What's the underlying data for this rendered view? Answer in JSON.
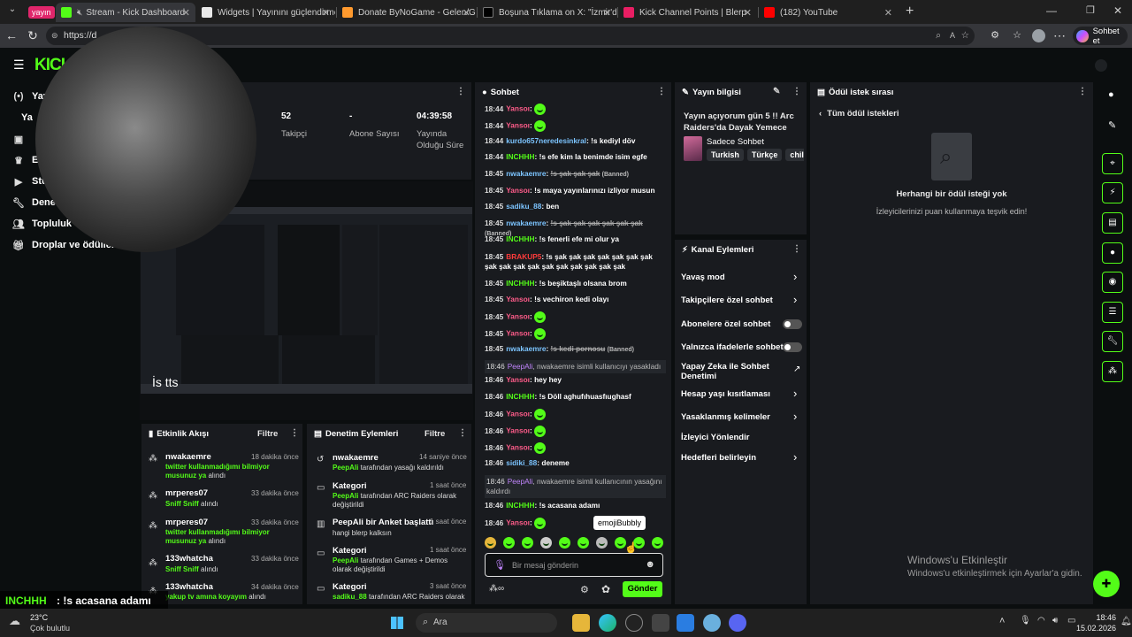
{
  "browser": {
    "tab_group": "yayın",
    "tabs": [
      {
        "title": "Stream - Kick Dashboard",
        "color": "#53fc18"
      },
      {
        "title": "Widgets | Yayınını güçlendirmek iç",
        "color": "#ffffff"
      },
      {
        "title": "Donate ByNoGame - Gelen/Giden",
        "color": "#ff9a2e"
      },
      {
        "title": "Boşuna Tıklama on X: \"İzmir'de bir",
        "color": "#000000"
      },
      {
        "title": "Kick Channel Points | Blerp",
        "color": "#e91e63"
      },
      {
        "title": "(182) YouTube",
        "color": "#ff0000"
      }
    ],
    "url": "https://d",
    "chat_button": "Sohbet et"
  },
  "sidebar": {
    "items": [
      {
        "label": "Yay",
        "icon": "broadcast-icon"
      },
      {
        "label": "Ya",
        "icon": ""
      },
      {
        "label": "",
        "icon": "layout-icon"
      },
      {
        "label": "E",
        "icon": "trophy-icon"
      },
      {
        "label": "Stu",
        "icon": "video-icon"
      },
      {
        "label": "Dene",
        "icon": "wrench-icon"
      },
      {
        "label": "Topluluk",
        "icon": "people-icon"
      },
      {
        "label": "Droplar ve ödüller",
        "icon": "gift-icon"
      }
    ]
  },
  "stats": [
    {
      "value": "52",
      "label": "Takipçi"
    },
    {
      "value": "-",
      "label": "Abone Sayısı"
    },
    {
      "value": "04:39:58",
      "label": "Yayında Olduğu Süre"
    }
  ],
  "overlay_caption": "İs tts",
  "activity": {
    "title": "Etkinlik Akışı",
    "filter": "Filtre",
    "items": [
      {
        "name": "nwakaemre",
        "time": "18 dakika önce",
        "text": "twitter kullanmadığımı bilmiyor musunuz ya",
        "suffix": "alındı"
      },
      {
        "name": "mrperes07",
        "time": "33 dakika önce",
        "text": "Sniff Sniff",
        "suffix": "alındı"
      },
      {
        "name": "mrperes07",
        "time": "33 dakika önce",
        "text": "twitter kullanmadığımı bilmiyor musunuz ya",
        "suffix": "alındı"
      },
      {
        "name": "133whatcha",
        "time": "33 dakika önce",
        "text": "Sniff Sniff",
        "suffix": "alındı"
      },
      {
        "name": "133whatcha",
        "time": "34 dakika önce",
        "text": "yakup tv amına koyayım",
        "suffix": "alındı"
      }
    ]
  },
  "moderation": {
    "title": "Denetim Eylemleri",
    "filter": "Filtre",
    "items": [
      {
        "title": "nwakaemre",
        "time": "14 saniye önce",
        "actor": "PeepAli",
        "text": "tarafından yasağı kaldırıldı",
        "icon": "undo-icon"
      },
      {
        "title": "Kategori",
        "time": "1 saat önce",
        "actor": "PeepAli",
        "text": "tarafından ARC Raiders olarak değiştirildi",
        "icon": "category-icon"
      },
      {
        "title": "PeepAli bir Anket başlattı",
        "time": "1 saat önce",
        "actor": "",
        "text": "hangi blerp kalksın",
        "icon": "poll-icon"
      },
      {
        "title": "Kategori",
        "time": "1 saat önce",
        "actor": "PeepAli",
        "text": "tarafından Games + Demos olarak değiştirildi",
        "icon": "category-icon"
      },
      {
        "title": "Kategori",
        "time": "3 saat önce",
        "actor": "sadiku_88",
        "text": "tarafından ARC Raiders olarak",
        "icon": "category-icon"
      }
    ]
  },
  "chat": {
    "title": "Sohbet",
    "lines": [
      {
        "time": "18:44",
        "user": "Yansoı",
        "color": "pink",
        "text": "",
        "emote": true
      },
      {
        "time": "18:44",
        "user": "Yansoı",
        "color": "pink",
        "text": "",
        "emote": true
      },
      {
        "time": "18:44",
        "user": "kurdo657neredesinkral",
        "color": "blue",
        "text": "!s kediyl döv"
      },
      {
        "time": "18:44",
        "user": "INCHHH",
        "color": "green",
        "text": "!s efe kim la benimde isim egfe"
      },
      {
        "time": "18:45",
        "user": "nwakaemre",
        "color": "blue",
        "text": "!s şak şak şak",
        "banned": "(Banned)"
      },
      {
        "time": "18:45",
        "user": "Yansoı",
        "color": "pink",
        "text": "!s maya yayınlarınızı izliyor musun"
      },
      {
        "time": "18:45",
        "user": "sadiku_88",
        "color": "blue",
        "text": "ben"
      },
      {
        "time": "18:45",
        "user": "nwakaemre",
        "color": "blue",
        "text": "!s şak şak şak şak şak şak",
        "banned": "(Banned)"
      },
      {
        "time": "18:45",
        "user": "INCHHH",
        "color": "green",
        "text": "!s fenerli efe mi olur ya"
      },
      {
        "time": "18:45",
        "user": "BRAKUP5",
        "color": "red",
        "text": "!s şak şak şak şak şak şak şak şak şak şak şak şak şak şak şak şak şak"
      },
      {
        "time": "18:45",
        "user": "INCHHH",
        "color": "green",
        "text": "!s beşiktaşlı olsana brom"
      },
      {
        "time": "18:45",
        "user": "Yansoı",
        "color": "pink",
        "text": "!s vechiron kedi olayı"
      },
      {
        "time": "18:45",
        "user": "Yansoı",
        "color": "pink",
        "text": "",
        "emote": true
      },
      {
        "time": "18:45",
        "user": "Yansoı",
        "color": "pink",
        "text": "",
        "emote": true
      },
      {
        "time": "18:45",
        "user": "nwakaemre",
        "color": "blue",
        "text": "!s kedi pornosu",
        "banned": "(Banned)"
      },
      {
        "time": "18:46",
        "user": "PeepAli",
        "color": "mod",
        "text": "nwakaemre isimli kullanıcıyı yasakladı"
      },
      {
        "time": "18:46",
        "user": "Yansoı",
        "color": "pink",
        "text": "hey hey"
      },
      {
        "time": "18:46",
        "user": "INCHHH",
        "color": "green",
        "text": "!s Döll aghufıhuasfıughasf"
      },
      {
        "time": "18:46",
        "user": "Yansoı",
        "color": "pink",
        "text": "",
        "emote": true
      },
      {
        "time": "18:46",
        "user": "Yansoı",
        "color": "pink",
        "text": "",
        "emote": true
      },
      {
        "time": "18:46",
        "user": "Yansoı",
        "color": "pink",
        "text": "",
        "emote": true
      },
      {
        "time": "18:46",
        "user": "sidiki_88",
        "color": "blue",
        "text": "deneme"
      },
      {
        "time": "18:46",
        "user": "PeepAli",
        "color": "mod",
        "text": "nwakaemre isimli kullanıcının yasağını kaldırdı"
      },
      {
        "time": "18:46",
        "user": "INCHHH",
        "color": "green",
        "text": "!s acasana adamı"
      },
      {
        "time": "18:46",
        "user": "Yansoı",
        "color": "pink",
        "text": "",
        "emote": true
      }
    ],
    "tooltip": "emojiBubbly",
    "input_placeholder": "Bir mesaj gönderin",
    "send_button": "Gönder"
  },
  "stream_info": {
    "title": "Yayın bilgisi",
    "stream_title": "Yayın açıyorum gün 5 !! Arc Raiders'da Dayak Yemece",
    "chat_mode": "Sadece Sohbet",
    "tags": [
      "Turkish",
      "Türkçe",
      "chil"
    ]
  },
  "channel_actions": {
    "title": "Kanal Eylemleri",
    "items": [
      {
        "label": "Yavaş mod",
        "kind": "arrow"
      },
      {
        "label": "Takipçilere özel sohbet",
        "kind": "arrow"
      },
      {
        "label": "Abonelere özel sohbet",
        "kind": "toggle"
      },
      {
        "label": "Yalnızca ifadelerle sohbet",
        "kind": "toggle"
      },
      {
        "label": "Yapay Zeka ile Sohbet Denetimi",
        "kind": "external"
      },
      {
        "label": "Hesap yaşı kısıtlaması",
        "kind": "arrow"
      },
      {
        "label": "Yasaklanmış kelimeler",
        "kind": "arrow"
      },
      {
        "label": "İzleyici Yönlendir",
        "kind": "none"
      },
      {
        "label": "Hedefleri belirleyin",
        "kind": "arrow"
      }
    ]
  },
  "rewards": {
    "title": "Ödül istek sırası",
    "back_label": "Tüm ödül istekleri",
    "empty_title": "Herhangi bir ödül isteği yok",
    "empty_sub": "İzleyicilerinizi puan kullanmaya teşvik edin!"
  },
  "watermark": {
    "line1": "Windows'u Etkinleştir",
    "line2": "Windows'u etkinleştirmek için Ayarlar'a gidin."
  },
  "bottom_overlay": {
    "user": "INCHHH",
    "text": ": !s acasana adamı"
  },
  "taskbar": {
    "temp": "23°C",
    "weather": "Çok bulutlu",
    "search": "Ara",
    "time": "18:46",
    "date": "15.02.2026"
  }
}
